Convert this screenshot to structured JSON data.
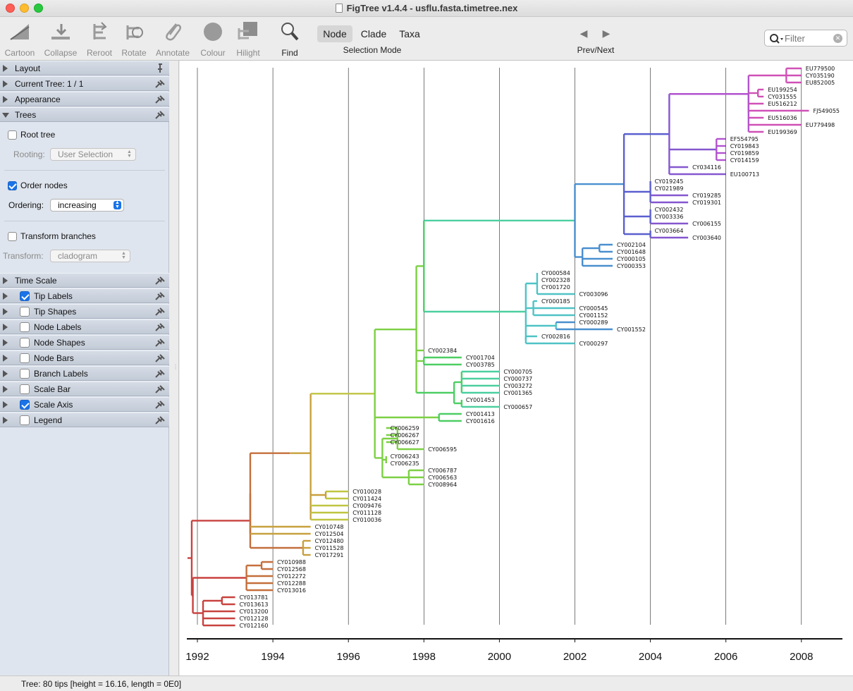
{
  "window": {
    "title": "FigTree v1.4.4 - usflu.fasta.timetree.nex"
  },
  "toolbar": {
    "tools": [
      {
        "id": "cartoon",
        "label": "Cartoon",
        "icon": "cartoon-icon"
      },
      {
        "id": "collapse",
        "label": "Collapse",
        "icon": "collapse-icon"
      },
      {
        "id": "reroot",
        "label": "Reroot",
        "icon": "reroot-icon"
      },
      {
        "id": "rotate",
        "label": "Rotate",
        "icon": "rotate-icon"
      },
      {
        "id": "annotate",
        "label": "Annotate",
        "icon": "paperclip-icon"
      },
      {
        "id": "colour",
        "label": "Colour",
        "icon": "colour-icon"
      },
      {
        "id": "hilight",
        "label": "Hilight",
        "icon": "hilight-icon"
      },
      {
        "id": "find",
        "label": "Find",
        "icon": "magnifier-icon"
      }
    ],
    "selection_mode": {
      "caption": "Selection Mode",
      "options": [
        "Node",
        "Clade",
        "Taxa"
      ],
      "selected": "Node"
    },
    "prev_next": {
      "prev": "◀",
      "next": "▶",
      "caption": "Prev/Next"
    },
    "filter": {
      "placeholder": "Filter"
    }
  },
  "sidebar": {
    "panels_top": [
      {
        "title": "Layout",
        "open": false
      },
      {
        "title": "Current Tree: 1 / 1",
        "open": false
      },
      {
        "title": "Appearance",
        "open": false
      },
      {
        "title": "Trees",
        "open": true
      }
    ],
    "trees": {
      "root_tree": {
        "label": "Root tree",
        "checked": false
      },
      "rooting": {
        "label": "Rooting:",
        "value": "User Selection"
      },
      "order_nodes": {
        "label": "Order nodes",
        "checked": true
      },
      "ordering": {
        "label": "Ordering:",
        "value": "increasing"
      },
      "transform_branches": {
        "label": "Transform branches",
        "checked": false
      },
      "transform": {
        "label": "Transform:",
        "value": "cladogram"
      }
    },
    "panels_bottom": [
      {
        "title": "Time Scale",
        "has_checkbox": false,
        "checked": false
      },
      {
        "title": "Tip Labels",
        "has_checkbox": true,
        "checked": true
      },
      {
        "title": "Tip Shapes",
        "has_checkbox": true,
        "checked": false
      },
      {
        "title": "Node Labels",
        "has_checkbox": true,
        "checked": false
      },
      {
        "title": "Node Shapes",
        "has_checkbox": true,
        "checked": false
      },
      {
        "title": "Node Bars",
        "has_checkbox": true,
        "checked": false
      },
      {
        "title": "Branch Labels",
        "has_checkbox": true,
        "checked": false
      },
      {
        "title": "Scale Bar",
        "has_checkbox": true,
        "checked": false
      },
      {
        "title": "Scale Axis",
        "has_checkbox": true,
        "checked": true
      },
      {
        "title": "Legend",
        "has_checkbox": true,
        "checked": false
      }
    ]
  },
  "tree": {
    "axis_ticks": [
      "1992",
      "1994",
      "1996",
      "1998",
      "2000",
      "2002",
      "2004",
      "2006",
      "2008"
    ],
    "axis_range": [
      1991.7,
      2009.1
    ],
    "colors": [
      "#c8423f",
      "#c46f3b",
      "#c8a03e",
      "#bfc541",
      "#7cd044",
      "#4dce63",
      "#4ccfa0",
      "#4fc3c6",
      "#4a8fcf",
      "#5a5fcf",
      "#8457cf",
      "#b153cf",
      "#d051b6",
      "#d74f82"
    ],
    "tips": [
      {
        "name": "EU779500",
        "date": 2008.0
      },
      {
        "name": "CY035190",
        "date": 2008.0
      },
      {
        "name": "EU852005",
        "date": 2008.0
      },
      {
        "name": "EU199254",
        "date": 2007.0
      },
      {
        "name": "CY031555",
        "date": 2007.0
      },
      {
        "name": "EU516212",
        "date": 2007.0
      },
      {
        "name": "FJ549055",
        "date": 2008.2
      },
      {
        "name": "EU516036",
        "date": 2007.0
      },
      {
        "name": "EU779498",
        "date": 2008.0
      },
      {
        "name": "EU199369",
        "date": 2007.0
      },
      {
        "name": "EF554795",
        "date": 2006.0
      },
      {
        "name": "CY019843",
        "date": 2006.0
      },
      {
        "name": "CY019859",
        "date": 2006.0
      },
      {
        "name": "CY014159",
        "date": 2006.0
      },
      {
        "name": "CY034116",
        "date": 2005.0
      },
      {
        "name": "EU100713",
        "date": 2006.0
      },
      {
        "name": "CY019245",
        "date": 2004.0
      },
      {
        "name": "CY021989",
        "date": 2004.0
      },
      {
        "name": "CY019285",
        "date": 2005.0
      },
      {
        "name": "CY019301",
        "date": 2005.0
      },
      {
        "name": "CY002432",
        "date": 2004.0
      },
      {
        "name": "CY003336",
        "date": 2004.0
      },
      {
        "name": "CY006155",
        "date": 2005.0
      },
      {
        "name": "CY003664",
        "date": 2004.0
      },
      {
        "name": "CY003640",
        "date": 2005.0
      },
      {
        "name": "CY002104",
        "date": 2003.0
      },
      {
        "name": "CY001648",
        "date": 2003.0
      },
      {
        "name": "CY000105",
        "date": 2003.0
      },
      {
        "name": "CY000353",
        "date": 2003.0
      },
      {
        "name": "CY000584",
        "date": 2001.0
      },
      {
        "name": "CY002328",
        "date": 2001.0
      },
      {
        "name": "CY001720",
        "date": 2001.0
      },
      {
        "name": "CY003096",
        "date": 2002.0
      },
      {
        "name": "CY000185",
        "date": 2001.0
      },
      {
        "name": "CY000545",
        "date": 2002.0
      },
      {
        "name": "CY001152",
        "date": 2002.0
      },
      {
        "name": "CY000289",
        "date": 2002.0
      },
      {
        "name": "CY001552",
        "date": 2003.0
      },
      {
        "name": "CY002816",
        "date": 2001.0
      },
      {
        "name": "CY000297",
        "date": 2002.0
      },
      {
        "name": "CY002384",
        "date": 1998.0
      },
      {
        "name": "CY001704",
        "date": 1999.0
      },
      {
        "name": "CY003785",
        "date": 1999.0
      },
      {
        "name": "CY000705",
        "date": 2000.0
      },
      {
        "name": "CY000737",
        "date": 2000.0
      },
      {
        "name": "CY003272",
        "date": 2000.0
      },
      {
        "name": "CY001365",
        "date": 2000.0
      },
      {
        "name": "CY001453",
        "date": 1999.0
      },
      {
        "name": "CY000657",
        "date": 2000.0
      },
      {
        "name": "CY001413",
        "date": 1999.0
      },
      {
        "name": "CY001616",
        "date": 1999.0
      },
      {
        "name": "CY006259",
        "date": 1997.0
      },
      {
        "name": "CY006267",
        "date": 1997.0
      },
      {
        "name": "CY006627",
        "date": 1997.0
      },
      {
        "name": "CY006595",
        "date": 1998.0
      },
      {
        "name": "CY006243",
        "date": 1997.0
      },
      {
        "name": "CY006235",
        "date": 1997.0
      },
      {
        "name": "CY006787",
        "date": 1998.0
      },
      {
        "name": "CY006563",
        "date": 1998.0
      },
      {
        "name": "CY008964",
        "date": 1998.0
      },
      {
        "name": "CY010028",
        "date": 1996.0
      },
      {
        "name": "CY011424",
        "date": 1996.0
      },
      {
        "name": "CY009476",
        "date": 1996.0
      },
      {
        "name": "CY011128",
        "date": 1996.0
      },
      {
        "name": "CY010036",
        "date": 1996.0
      },
      {
        "name": "CY010748",
        "date": 1995.0
      },
      {
        "name": "CY012504",
        "date": 1995.0
      },
      {
        "name": "CY012480",
        "date": 1995.0
      },
      {
        "name": "CY011528",
        "date": 1995.0
      },
      {
        "name": "CY017291",
        "date": 1995.0
      },
      {
        "name": "CY010988",
        "date": 1994.0
      },
      {
        "name": "CY012568",
        "date": 1994.0
      },
      {
        "name": "CY012272",
        "date": 1994.0
      },
      {
        "name": "CY012288",
        "date": 1994.0
      },
      {
        "name": "CY013016",
        "date": 1994.0
      },
      {
        "name": "CY013781",
        "date": 1993.0
      },
      {
        "name": "CY013613",
        "date": 1993.0
      },
      {
        "name": "CY013200",
        "date": 1993.0
      },
      {
        "name": "CY012128",
        "date": 1993.0
      },
      {
        "name": "CY012160",
        "date": 1993.0
      }
    ]
  },
  "status": {
    "text": "Tree: 80 tips [height = 16.16, length = 0E0]"
  }
}
